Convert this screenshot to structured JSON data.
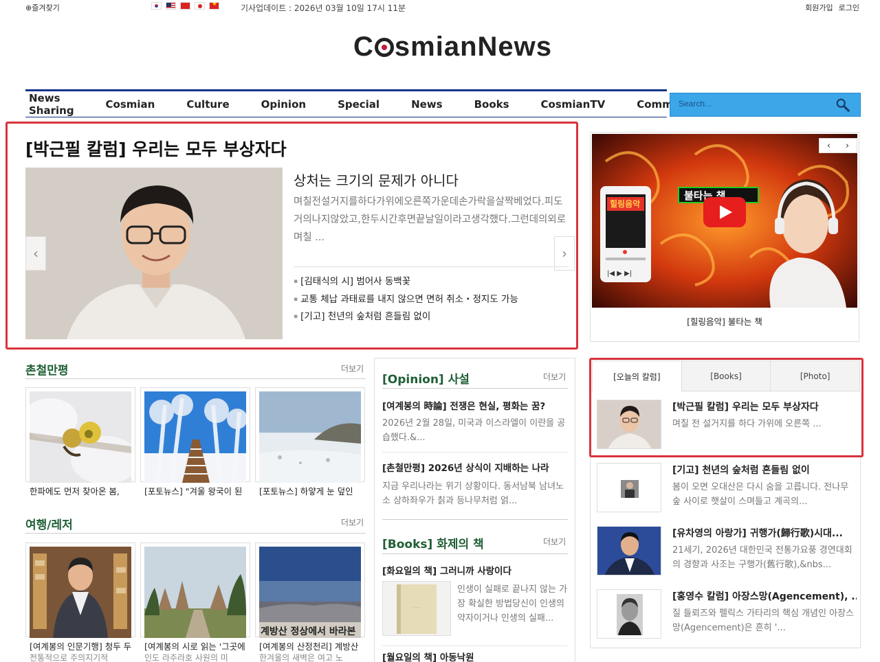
{
  "topbar": {
    "bookmark": "⊕즐겨찾기",
    "update": "기사업데이트 : 2026년 03월 10일 17시 11분",
    "signup": "회원가입",
    "login": "로그인"
  },
  "logo": {
    "pre": "C",
    "post": "smianNews"
  },
  "nav": {
    "items": [
      "News Sharing",
      "Cosmian",
      "Culture",
      "Opinion",
      "Special",
      "News",
      "Books",
      "CosmianTV",
      "Community"
    ],
    "search_placeholder": "Search..."
  },
  "headline": {
    "title": "[박근필 칼럼] 우리는 모두 부상자다",
    "subtitle": "상처는 크기의 문제가 아니다",
    "body": "며칠전설거지를하다가위에오른쪽가운데손가락을살짝베었다.피도거의나지않았고,한두시간후면끝날일이라고생각했다.그런데의외로며칠 ...",
    "links": [
      "[김태식의 시] 범어사 동백꽃",
      "교통 체납 과태료를 내지 않으면 면허 취소・정지도 가능",
      "[기고] 천년의 숲처럼 흔들림 없이"
    ]
  },
  "video": {
    "caption": "[힐링음악] 불타는 책",
    "banner": "불타는 책",
    "player_title": "힐링음악"
  },
  "section1": {
    "title": "촌철만평",
    "more": "더보기",
    "cards": [
      {
        "caption": "한파에도 먼저 찾아온 봄,",
        "caption2": ""
      },
      {
        "caption": "[포토뉴스] \"겨울 왕국이 된",
        "caption2": ""
      },
      {
        "caption": "[포토뉴스] 하얗게 눈 덮인",
        "caption2": ""
      }
    ]
  },
  "section2": {
    "title": "여행/레저",
    "more": "더보기",
    "cards": [
      {
        "caption": "[여계봉의 인문기행] 청두 두",
        "caption2": "전통적으로 주의지기적"
      },
      {
        "caption": "[여계봉의 시로 읽는 '그곳에",
        "caption2": "인도 라주라호 사원의 미"
      },
      {
        "caption": "[여계봉의 산정천리] 계방산",
        "caption2": "한겨울의 새벽은 여고 노"
      }
    ],
    "card3_overlay": "계방산 정상에서 바라본"
  },
  "opinion": {
    "tag": "[Opinion]",
    "title": "사설",
    "more": "더보기",
    "article1_title": "[여계봉의 時論] 전쟁은 현실, 평화는 꿈?",
    "article1_body": "2026년 2월 28일, 미국과 이스라엘이 이란을 공습했다.&...",
    "article2_title": "[촌철만평] 2026년 상식이 지배하는 나라",
    "article2_body": " 지금 우리나라는 위기 상황이다. 동서남북 남녀노소 상하좌우가 칡과 등나무처럼 얽..."
  },
  "books": {
    "tag": "[Books]",
    "title": "화제의 책",
    "more": "더보기",
    "article1_title": "[화요일의 책] 그러니까 사랑이다",
    "article1_body": "인생이 실패로 끝나지 않는 가장 확실한 방법당신이 인생의 약자이거나 인생의 실패...",
    "article2_title": "[월요일의 책] 아동낙원"
  },
  "tabs": [
    "[오늘의 칼럼]",
    "[Books]",
    "[Photo]"
  ],
  "columns": [
    {
      "title": "[박근필 칼럼] 우리는 모두 부상자다",
      "body": "며칠 전 설거지를 하다 가위에 오른쪽 ..."
    },
    {
      "title": "[기고] 천년의 숲처럼 흔들림 없이",
      "body": "봄이 오면 오대산은 다시 숨을 고릅니다. 전나무 숲 사이로 햇살이 스며들고 계곡의..."
    },
    {
      "title": "[유차영의 아랑가] 귀행가(歸行歌)시대...",
      "body": "21세기, 2026년 대한민국 전통가요풍 경연대회의 경향과 사조는 구행가(舊行歌),&nbs..."
    },
    {
      "title": "[홍영수 칼럼] 아장스망(Agencement), ...",
      "body": "질 들뢰즈와 펠릭스 가타리의 핵심 개념인 아장스망(Agencement)은 흔히 '..."
    }
  ],
  "colors": {
    "nav_blue": "#15338a",
    "search_blue": "#3ba7e9",
    "section_green": "#1f5f35",
    "highlight_red": "#d8333c",
    "logo_red": "#c8173a"
  }
}
